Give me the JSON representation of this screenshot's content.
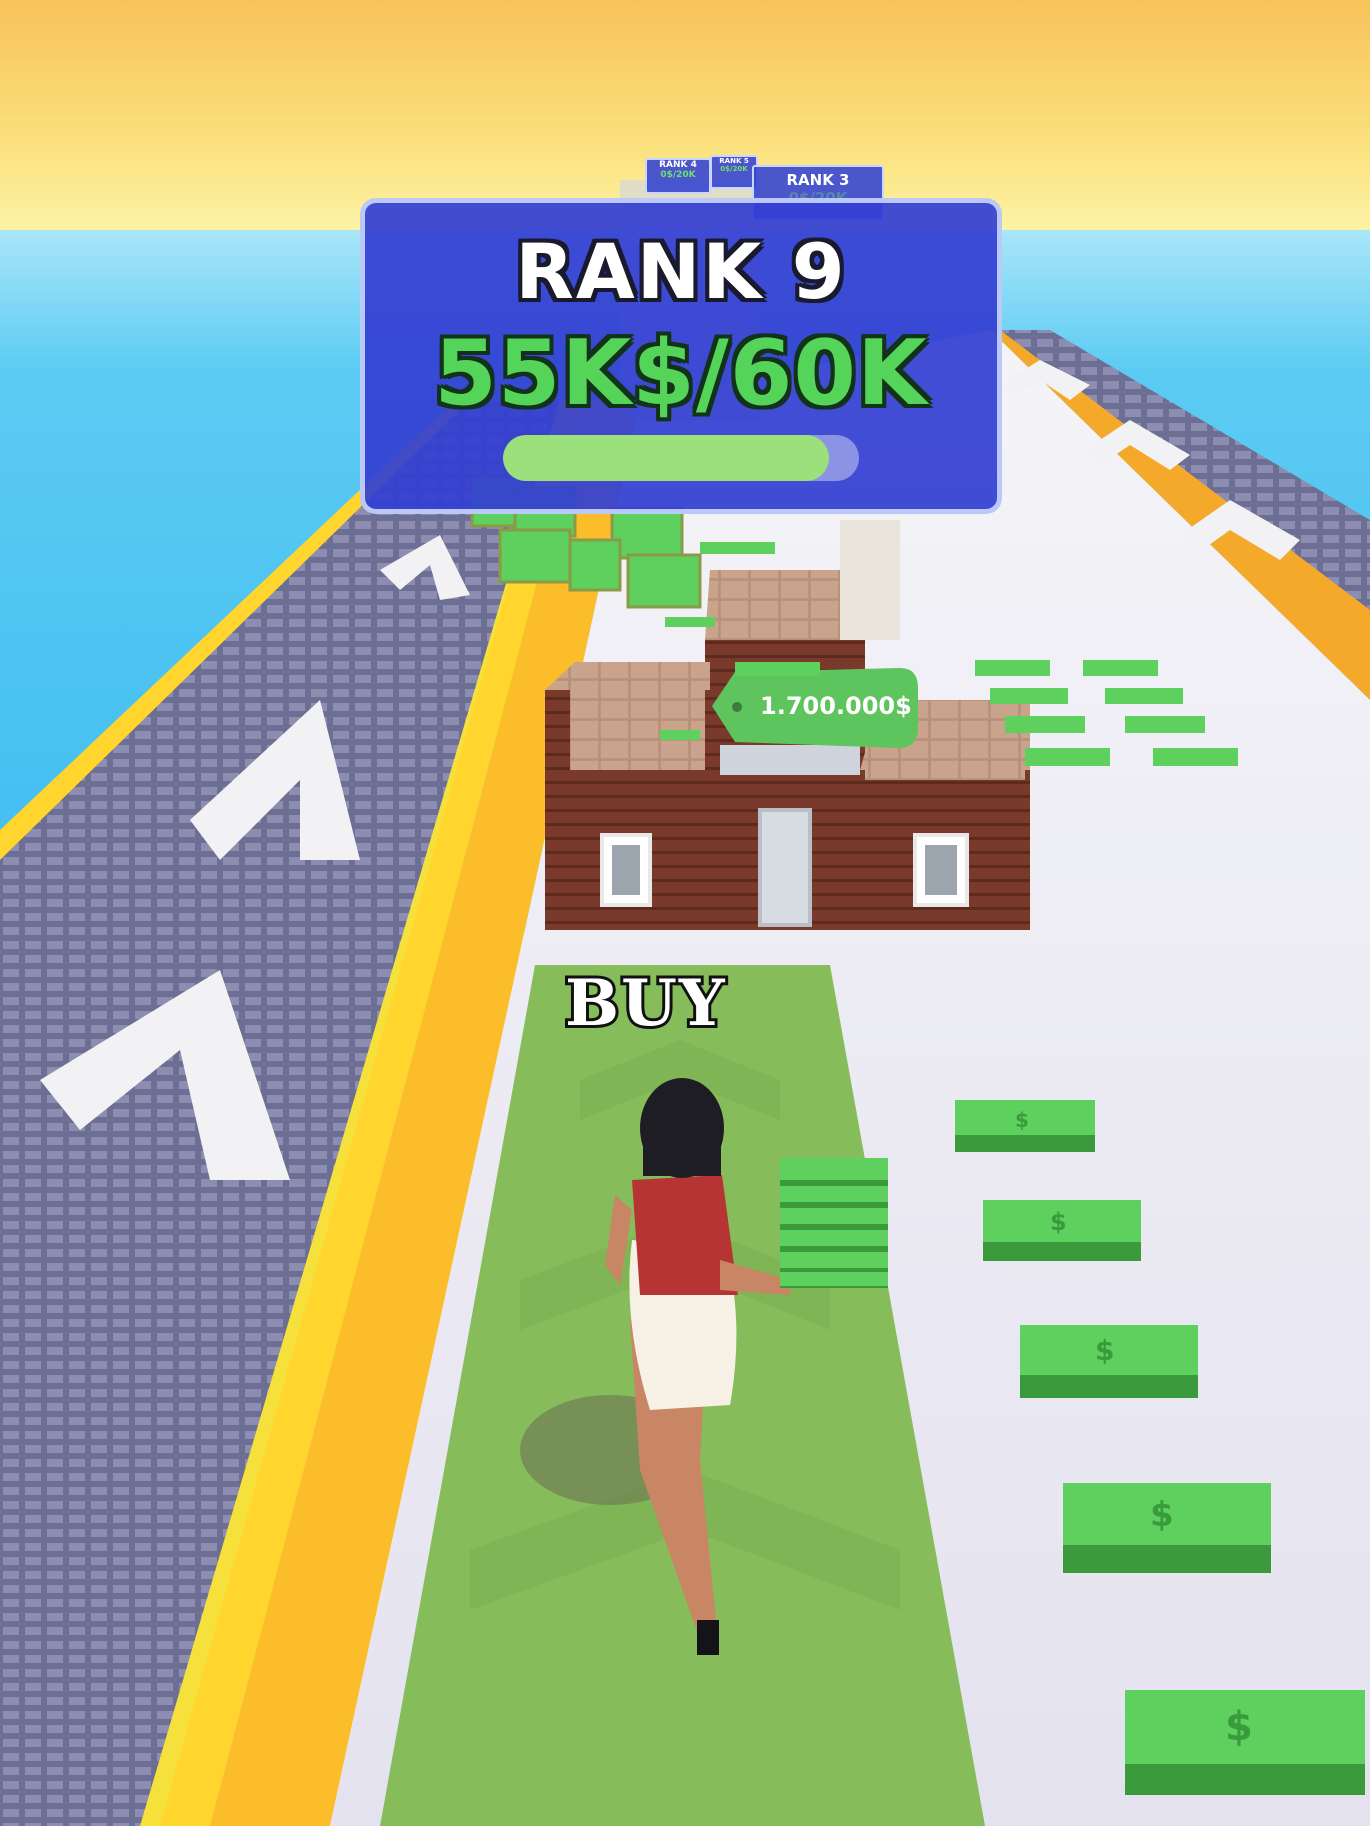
{
  "hud": {
    "rank_title": "RANK 9",
    "rank_progress_text": "55K$/60K",
    "progress_fraction": 0.917
  },
  "leaderboard_preview": [
    {
      "title": "RANK 4",
      "value": "0$/20K"
    },
    {
      "title": "RANK 5",
      "value": "0$/20K"
    },
    {
      "title": "RANK 3",
      "value": "0$/20K"
    }
  ],
  "building": {
    "price_label": "1.700.000$"
  },
  "track": {
    "buy_label": "BUY"
  },
  "colors": {
    "sky_top": "#f9c65a",
    "sky_bottom": "#fdf59a",
    "sea": "#4fc7f2",
    "panel_blue": "#3440d2",
    "money_green": "#55d45a",
    "runway_green": "#89bf5a"
  },
  "icons": {
    "player": "runner-character",
    "money": "cash-bundle-icon"
  }
}
